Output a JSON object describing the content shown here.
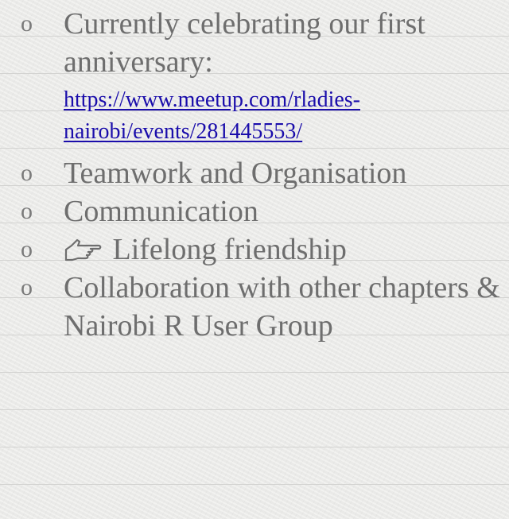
{
  "bullet_symbol": "o",
  "items": [
    {
      "text": "Currently celebrating our first anniversary:",
      "link": "https://www.meetup.com/rladies-nairobi/events/281445553/"
    },
    {
      "text": "Teamwork and Organisation"
    },
    {
      "text": "Communication"
    },
    {
      "text": "Lifelong friendship",
      "icon": "pointing-hand-icon"
    },
    {
      "text": "Collaboration with other chapters & Nairobi R User Group"
    }
  ],
  "colors": {
    "text": "#6e6e6e",
    "link": "#1a0dab",
    "background": "#efefed",
    "rule_lines": "#d3d3d1"
  }
}
